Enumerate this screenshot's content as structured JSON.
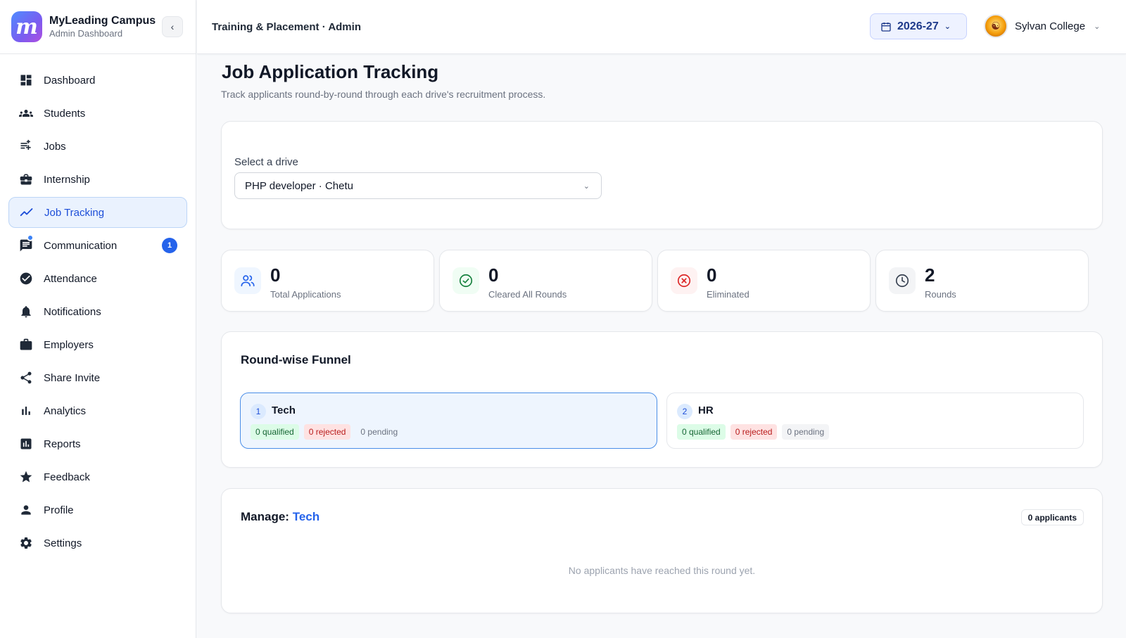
{
  "brand": {
    "name": "MyLeading Campus",
    "subtitle": "Admin Dashboard",
    "logo_letter": "m"
  },
  "sidebar": {
    "collapse_icon": "chevron-left-icon",
    "items": [
      {
        "label": "Dashboard",
        "icon": "dashboard-icon"
      },
      {
        "label": "Students",
        "icon": "students-icon"
      },
      {
        "label": "Jobs",
        "icon": "jobs-icon"
      },
      {
        "label": "Internship",
        "icon": "briefcase-icon"
      },
      {
        "label": "Job Tracking",
        "icon": "trend-icon",
        "active": true
      },
      {
        "label": "Communication",
        "icon": "chat-icon",
        "badge": "1"
      },
      {
        "label": "Attendance",
        "icon": "check-circle-icon"
      },
      {
        "label": "Notifications",
        "icon": "bell-icon"
      },
      {
        "label": "Employers",
        "icon": "case-icon"
      },
      {
        "label": "Share Invite",
        "icon": "share-icon"
      },
      {
        "label": "Analytics",
        "icon": "bar-chart-icon"
      },
      {
        "label": "Reports",
        "icon": "report-icon"
      },
      {
        "label": "Feedback",
        "icon": "star-icon"
      },
      {
        "label": "Profile",
        "icon": "person-icon"
      },
      {
        "label": "Settings",
        "icon": "gear-icon"
      }
    ]
  },
  "header": {
    "breadcrumb": "Training & Placement · Admin",
    "year": "2026-27",
    "user_name": "Sylvan College"
  },
  "page": {
    "title": "Job Application Tracking",
    "subtitle": "Track applicants round-by-round through each drive's recruitment process."
  },
  "drive": {
    "label": "Select a drive",
    "selected": "PHP developer · Chetu"
  },
  "stats": [
    {
      "value": "0",
      "label": "Total Applications",
      "icon": "users-icon",
      "color": "#2563eb"
    },
    {
      "value": "0",
      "label": "Cleared All Rounds",
      "icon": "check-circle-icon",
      "color": "#15803d"
    },
    {
      "value": "0",
      "label": "Eliminated",
      "icon": "x-circle-icon",
      "color": "#dc2626"
    },
    {
      "value": "2",
      "label": "Rounds",
      "icon": "clock-icon",
      "color": "#374151"
    }
  ],
  "funnel": {
    "title": "Round-wise Funnel",
    "rounds": [
      {
        "index": "1",
        "name": "Tech",
        "qualified": "0 qualified",
        "rejected": "0 rejected",
        "pending": "0 pending",
        "active": true
      },
      {
        "index": "2",
        "name": "HR",
        "qualified": "0 qualified",
        "rejected": "0 rejected",
        "pending": "0 pending",
        "active": false
      }
    ]
  },
  "manage": {
    "prefix": "Manage:",
    "round": "Tech",
    "applicants": "0 applicants",
    "empty": "No applicants have reached this round yet."
  }
}
